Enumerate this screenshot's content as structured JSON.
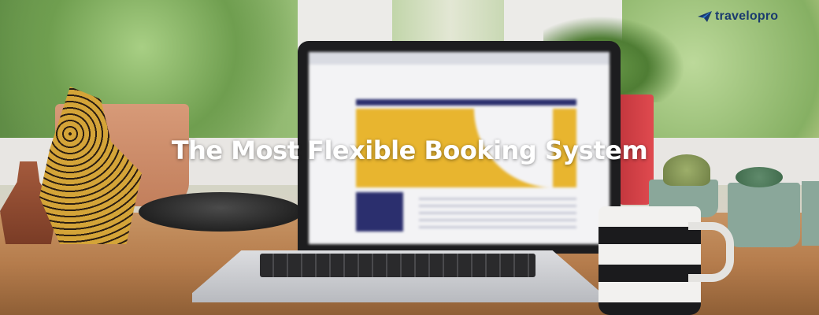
{
  "hero": {
    "headline": "The Most Flexible Booking System"
  },
  "brand": {
    "name": "travelopro",
    "logo_icon": "paper-plane-icon",
    "color_primary": "#1a3a6e",
    "color_accent": "#2f7fd8"
  }
}
